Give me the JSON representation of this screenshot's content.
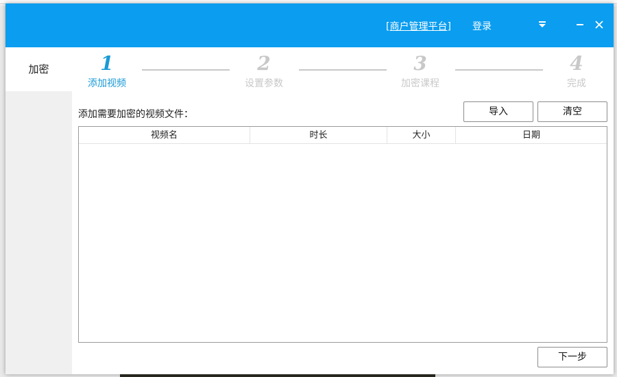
{
  "header": {
    "platform_link": "[商户管理平台]",
    "login": "登录",
    "icons": [
      "dropdown-icon",
      "minimize-icon",
      "close-icon"
    ],
    "accent_color": "#0a9df0"
  },
  "sidebar": {
    "items": [
      {
        "label": "加密"
      }
    ]
  },
  "steps": [
    {
      "num": "1",
      "label": "添加视频",
      "state": "active"
    },
    {
      "num": "2",
      "label": "设置参数",
      "state": "inactive"
    },
    {
      "num": "3",
      "label": "加密课程",
      "state": "inactive"
    },
    {
      "num": "4",
      "label": "完成",
      "state": "inactive"
    }
  ],
  "main": {
    "prompt": "添加需要加密的视频文件：",
    "import_label": "导入",
    "clear_label": "清空",
    "next_label": "下一步",
    "columns": [
      "视频名",
      "时长",
      "大小",
      "日期"
    ],
    "rows": []
  }
}
